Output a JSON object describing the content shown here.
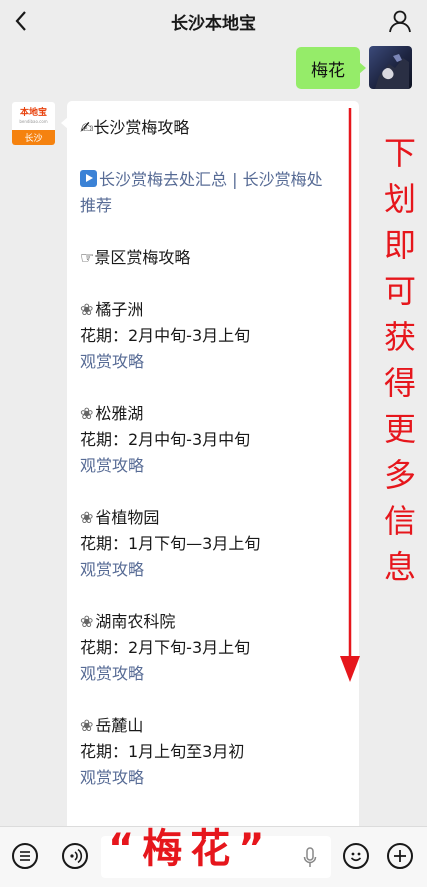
{
  "header": {
    "title": "长沙本地宝",
    "back_icon": "chevron-left-icon",
    "profile_icon": "person-icon"
  },
  "user_message": {
    "text": "梅花",
    "bubble_color": "#95ec69"
  },
  "bot_avatar": {
    "brand": "本地宝",
    "url": "bendibao.com",
    "city": "长沙"
  },
  "bot_message": {
    "heading": "✍长沙赏梅攻略",
    "links_part1": "长沙赏梅去处汇总",
    "links_sep": " | ",
    "links_part2_line1": "长沙赏梅处",
    "links_part2_line2": "推荐",
    "section_title": "☞景区赏梅攻略",
    "spots": [
      {
        "name": "橘子洲",
        "period": "花期：2月中旬-3月上旬",
        "link": "观赏攻略"
      },
      {
        "name": "松雅湖",
        "period": "花期：2月中旬-3月中旬",
        "link": "观赏攻略"
      },
      {
        "name": "省植物园",
        "period": "花期：1月下旬—3月上旬",
        "link": "观赏攻略"
      },
      {
        "name": "湖南农科院",
        "period": "花期：2月下旬-3月上旬",
        "link": "观赏攻略"
      },
      {
        "name": "岳麓山",
        "period": "花期：1月上旬至3月初",
        "link": "观赏攻略"
      }
    ]
  },
  "annotation": {
    "vertical_text": [
      "下",
      "划",
      "即",
      "可",
      "获",
      "得",
      "更",
      "多",
      "信",
      "息"
    ],
    "overlay_text": "“梅花”",
    "color": "#e6161c"
  },
  "input_bar": {
    "left_icons": [
      "list-icon",
      "voice-icon"
    ],
    "right_icons": [
      "emoji-icon",
      "plus-icon"
    ],
    "mic_icon": "mic-icon"
  }
}
